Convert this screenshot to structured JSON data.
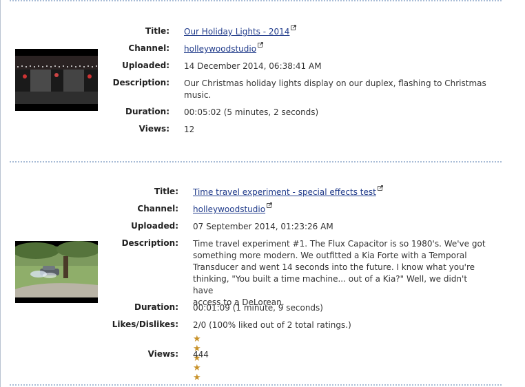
{
  "icons": {
    "external": "external-link-icon",
    "star": "star-icon"
  },
  "colors": {
    "link": "#1f3a8a",
    "separator": "#a8bcd6",
    "star": "#c8922a"
  },
  "videos": [
    {
      "title_label": "Title:",
      "title": "Our Holiday Lights - 2014",
      "channel_label": "Channel:",
      "channel": "holleywoodstudio",
      "uploaded_label": "Uploaded:",
      "uploaded": "14 December 2014, 06:38:41 AM",
      "description_label": "Description:",
      "description_lines": [
        "Our Christmas holiday lights display on our duplex, flashing to Christmas",
        "music."
      ],
      "duration_label": "Duration:",
      "duration": "00:05:02 (5 minutes, 2 seconds)",
      "views_label": "Views:",
      "views": "12"
    },
    {
      "title_label": "Title:",
      "title": "Time travel experiment - special effects test",
      "channel_label": "Channel:",
      "channel": "holleywoodstudio",
      "uploaded_label": "Uploaded:",
      "uploaded": "07 September 2014, 01:23:26 AM",
      "description_label": "Description:",
      "description_lines": [
        "Time travel experiment #1. The Flux Capacitor is so 1980's. We've got",
        "something more modern. We outfitted a Kia Forte with a Temporal",
        "Transducer and went 14 seconds into the future. I know what you're",
        "thinking, \"You built a time machine... out of a Kia?\" Well, we didn't have",
        "access to a DeLorean."
      ],
      "duration_label": "Duration:",
      "duration": "00:01:09 (1 minute, 9 seconds)",
      "likes_label": "Likes/Dislikes:",
      "likes": "2/0 (100% liked out of 2 total ratings.)",
      "rating_stars": 5,
      "views_label": "Views:",
      "views": "444"
    }
  ]
}
